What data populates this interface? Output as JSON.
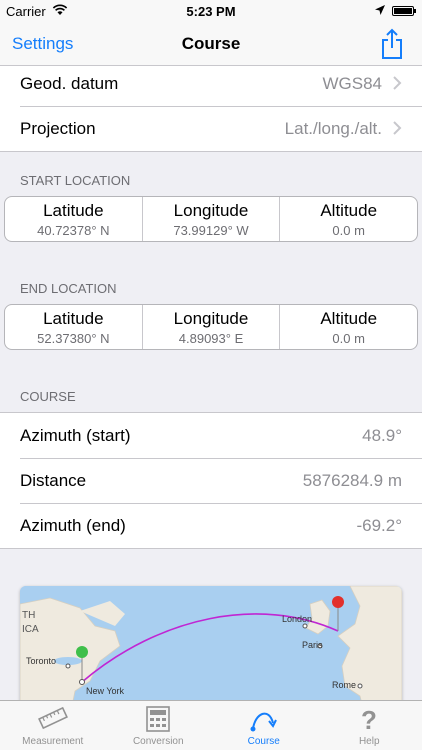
{
  "status": {
    "carrier": "Carrier",
    "time": "5:23 PM"
  },
  "nav": {
    "back": "Settings",
    "title": "Course"
  },
  "settings_rows": [
    {
      "label": "Geod. datum",
      "value": "WGS84"
    },
    {
      "label": "Projection",
      "value": "Lat./long./alt."
    }
  ],
  "start": {
    "header": "START LOCATION",
    "cells": [
      {
        "heading": "Latitude",
        "value": "40.72378° N"
      },
      {
        "heading": "Longitude",
        "value": "73.99129° W"
      },
      {
        "heading": "Altitude",
        "value": "0.0 m"
      }
    ]
  },
  "end": {
    "header": "END LOCATION",
    "cells": [
      {
        "heading": "Latitude",
        "value": "52.37380° N"
      },
      {
        "heading": "Longitude",
        "value": "4.89093° E"
      },
      {
        "heading": "Altitude",
        "value": "0.0 m"
      }
    ]
  },
  "course": {
    "header": "COURSE",
    "rows": [
      {
        "label": "Azimuth (start)",
        "value": "48.9°"
      },
      {
        "label": "Distance",
        "value": "5876284.9 m"
      },
      {
        "label": "Azimuth (end)",
        "value": "-69.2°"
      }
    ]
  },
  "map": {
    "labels": [
      "TH",
      "ICA",
      "Toronto",
      "New York",
      "London",
      "Paris",
      "Rome"
    ]
  },
  "tabs": [
    {
      "label": "Measurement",
      "icon": "ruler-icon"
    },
    {
      "label": "Conversion",
      "icon": "calculator-icon"
    },
    {
      "label": "Course",
      "icon": "course-arc-icon",
      "active": true
    },
    {
      "label": "Help",
      "icon": "question-icon"
    }
  ],
  "colors": {
    "tint": "#157efb",
    "path": "#c026d3",
    "water": "#a9cff0",
    "land": "#efeadf"
  }
}
